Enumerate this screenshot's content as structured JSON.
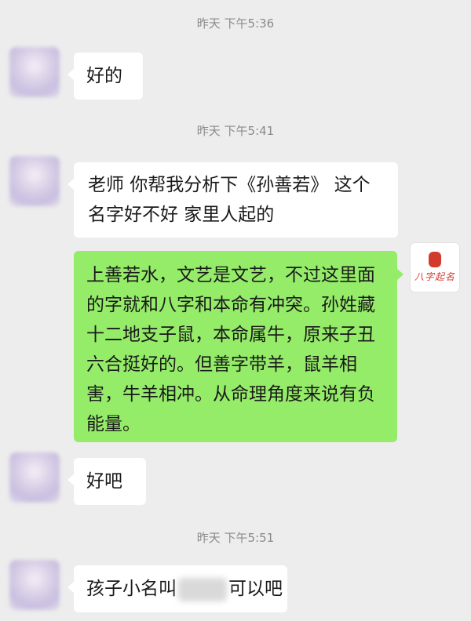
{
  "messages": [
    {
      "type": "timestamp",
      "text": "昨天 下午5:36"
    },
    {
      "type": "left",
      "text": "好的"
    },
    {
      "type": "timestamp",
      "text": "昨天 下午5:41"
    },
    {
      "type": "left",
      "text": "老师  你帮我分析下《孙善若》 这个名字好不好  家里人起的"
    },
    {
      "type": "right",
      "text": "上善若水，文艺是文艺，不过这里面的字就和八字和本命有冲突。孙姓藏十二地支子鼠，本命属牛，原来子丑六合挺好的。但善字带羊，鼠羊相害，牛羊相冲。从命理角度来说有负能量。"
    },
    {
      "type": "left",
      "text": "好吧"
    },
    {
      "type": "timestamp",
      "text": "昨天 下午5:51"
    },
    {
      "type": "left",
      "text_before": "孩子小名叫",
      "text_after": "可以吧"
    }
  ],
  "contact": {
    "brand": "八字起名"
  },
  "colors": {
    "background": "#ededed",
    "self_bubble": "#95ec69",
    "other_bubble": "#ffffff"
  },
  "icons": {
    "avatar_left": "blurred-avatar",
    "avatar_right": "seal-logo"
  }
}
